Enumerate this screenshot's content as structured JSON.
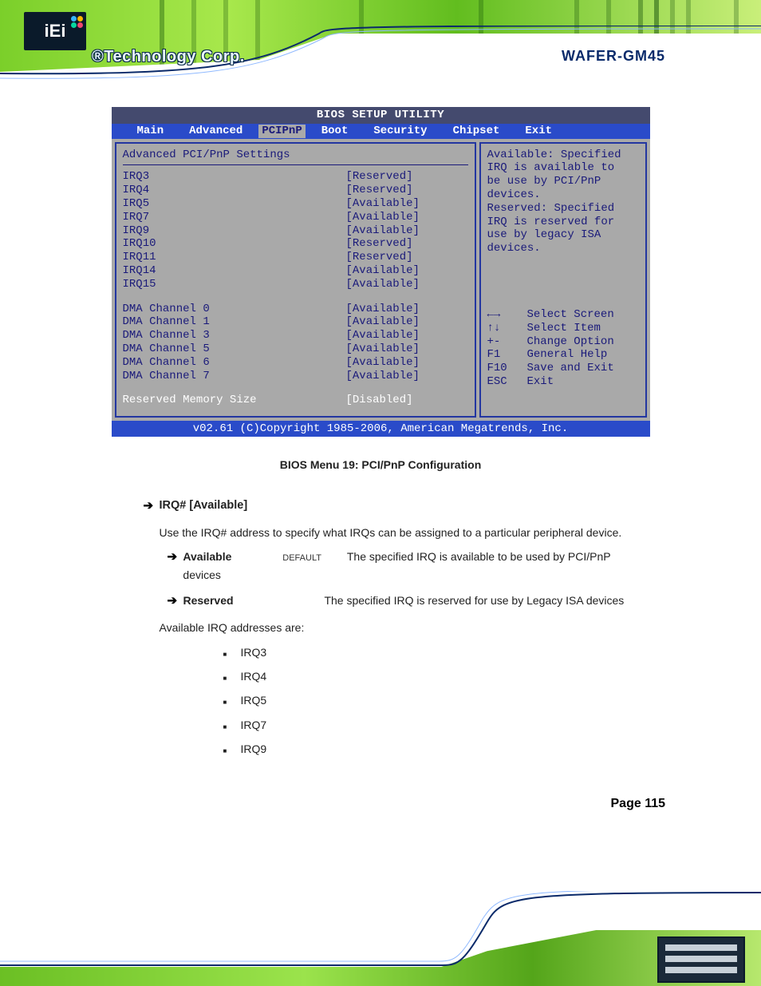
{
  "header": {
    "logo_text": "iEi",
    "brand_text": "®Technology Corp.",
    "model": "WAFER-GM45"
  },
  "bios": {
    "title": "BIOS SETUP UTILITY",
    "tabs": [
      "Main",
      "Advanced",
      "PCIPnP",
      "Boot",
      "Security",
      "Chipset",
      "Exit"
    ],
    "active_tab": "PCIPnP",
    "pane_title": "Advanced PCI/PnP Settings",
    "irq": [
      {
        "name": "IRQ3",
        "value": "[Reserved]"
      },
      {
        "name": "IRQ4",
        "value": "[Reserved]"
      },
      {
        "name": "IRQ5",
        "value": "[Available]"
      },
      {
        "name": "IRQ7",
        "value": "[Available]"
      },
      {
        "name": "IRQ9",
        "value": "[Available]"
      },
      {
        "name": "IRQ10",
        "value": "[Reserved]"
      },
      {
        "name": "IRQ11",
        "value": "[Reserved]"
      },
      {
        "name": "IRQ14",
        "value": "[Available]"
      },
      {
        "name": "IRQ15",
        "value": "[Available]"
      }
    ],
    "dma": [
      {
        "name": "DMA Channel 0",
        "value": "[Available]"
      },
      {
        "name": "DMA Channel 1",
        "value": "[Available]"
      },
      {
        "name": "DMA Channel 3",
        "value": "[Available]"
      },
      {
        "name": "DMA Channel 5",
        "value": "[Available]"
      },
      {
        "name": "DMA Channel 6",
        "value": "[Available]"
      },
      {
        "name": "DMA Channel 7",
        "value": "[Available]"
      }
    ],
    "reserved_mem": {
      "name": "Reserved Memory Size",
      "value": "[Disabled]"
    },
    "help_lines": [
      "Available: Specified",
      "IRQ is available to",
      "be use by PCI/PnP",
      "devices.",
      "Reserved: Specified",
      "IRQ is reserved for",
      "use by legacy ISA",
      "devices."
    ],
    "keys": [
      {
        "k": "←→",
        "d": "Select Screen"
      },
      {
        "k": "↑↓",
        "d": "Select Item"
      },
      {
        "k": "+-",
        "d": "Change Option"
      },
      {
        "k": "F1",
        "d": "General Help"
      },
      {
        "k": "F10",
        "d": "Save and Exit"
      },
      {
        "k": "ESC",
        "d": "Exit"
      }
    ],
    "copyright": "v02.61 (C)Copyright 1985-2006, American Megatrends, Inc."
  },
  "doc": {
    "menu_label": "BIOS Menu 19: PCI/PnP Configuration",
    "section_irq_title": "IRQ# [Available]",
    "section_irq_text": "Use the IRQ# address to specify what IRQs can be assigned to a particular peripheral device.",
    "opt_available": {
      "name": "Available",
      "tag": "DEFAULT",
      "desc": "The specified IRQ is available to be used by PCI/PnP devices"
    },
    "opt_reserved": {
      "name": "Reserved",
      "desc": "The specified IRQ is reserved for use by Legacy ISA devices"
    },
    "avail_irq_intro": "Available IRQ addresses are:",
    "avail_irq_list": [
      "IRQ3",
      "IRQ4",
      "IRQ5",
      "IRQ7",
      "IRQ9"
    ],
    "page_number": "Page 115"
  }
}
